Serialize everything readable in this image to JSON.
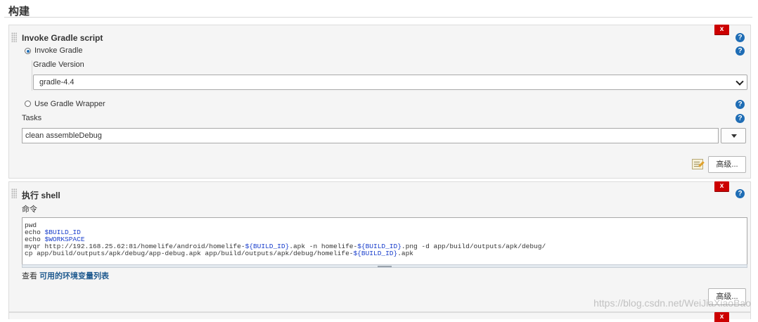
{
  "section": {
    "title": "构建"
  },
  "gradle_step": {
    "title": "Invoke Gradle script",
    "delete_label": "x",
    "help_glyph": "?",
    "invoke_gradle_label": "Invoke Gradle",
    "invoke_gradle_selected": true,
    "gradle_version_label": "Gradle Version",
    "gradle_version_value": "gradle-4.4",
    "use_wrapper_label": "Use Gradle Wrapper",
    "use_wrapper_selected": false,
    "tasks_label": "Tasks",
    "tasks_value": "clean assembleDebug",
    "advanced_label": "高级...",
    "icons": {
      "notepad": "notepad-icon",
      "help": "help-icon",
      "chevron": "chevron-down-icon"
    }
  },
  "shell_step": {
    "title": "执行 shell",
    "delete_label": "x",
    "help_glyph": "?",
    "command_label": "命令",
    "command_lines": [
      [
        {
          "t": "pwd",
          "v": false
        }
      ],
      [
        {
          "t": "echo ",
          "v": false
        },
        {
          "t": "$BUILD_ID",
          "v": true
        }
      ],
      [
        {
          "t": "echo ",
          "v": false
        },
        {
          "t": "$WORKSPACE",
          "v": true
        }
      ],
      [
        {
          "t": "myqr http://192.168.25.62:81/homelife/android/homelife-",
          "v": false
        },
        {
          "t": "${BUILD_ID}",
          "v": true
        },
        {
          "t": ".apk -n homelife-",
          "v": false
        },
        {
          "t": "${BUILD_ID}",
          "v": true
        },
        {
          "t": ".png -d app/build/outputs/apk/debug/",
          "v": false
        }
      ],
      [
        {
          "t": "cp app/build/outputs/apk/debug/app-debug.apk app/build/outputs/apk/debug/homelife-",
          "v": false
        },
        {
          "t": "${BUILD_ID}",
          "v": true
        },
        {
          "t": ".apk",
          "v": false
        }
      ]
    ],
    "env_prefix": "查看 ",
    "env_link": "可用的环境变量列表",
    "advanced_label": "高级..."
  },
  "next_step": {
    "delete_label": "x"
  },
  "watermark": "https://blog.csdn.net/WeiJiaXiaoBao",
  "colors": {
    "delete": "#cc0000",
    "help": "#1f6db5",
    "link": "#1f5a8f",
    "variable": "#1a3fcc"
  }
}
